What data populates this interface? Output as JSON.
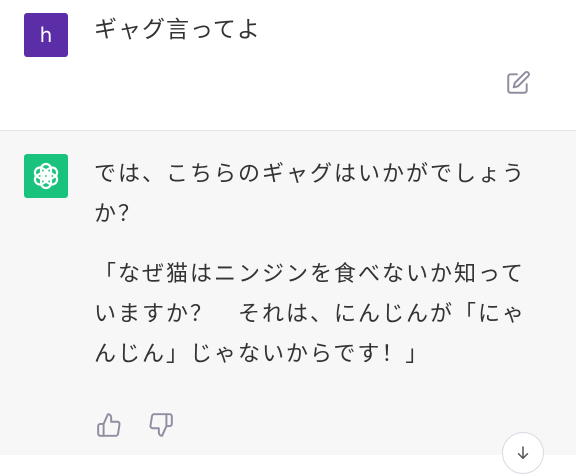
{
  "user": {
    "avatar_letter": "h",
    "message": "ギャグ言ってよ"
  },
  "assistant": {
    "paragraphs": [
      "では、こちらのギャグはいかがでしょうか？",
      "「なぜ猫はニンジンを食べないか知っていますか？　それは、にんじんが「にゃんじん」じゃないからです！」"
    ]
  },
  "colors": {
    "user_avatar": "#5b2ea8",
    "assistant_avatar": "#19c37d",
    "assistant_background": "#f7f7f8"
  },
  "icons": {
    "edit": "pencil-square-icon",
    "thumbs_up": "thumbs-up-icon",
    "thumbs_down": "thumbs-down-icon",
    "scroll_down": "arrow-down-icon",
    "assistant_logo": "openai-logo-icon"
  }
}
